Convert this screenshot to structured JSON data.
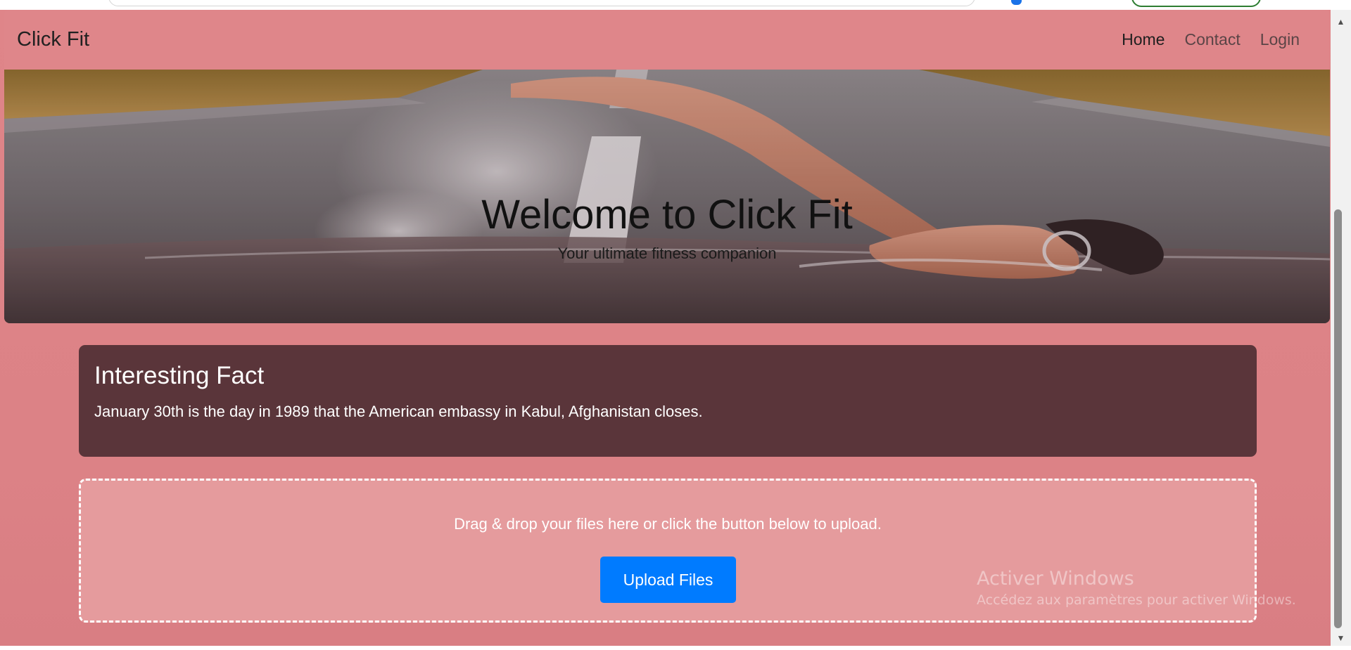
{
  "navbar": {
    "brand": "Click Fit",
    "links": [
      {
        "label": "Home",
        "active": true
      },
      {
        "label": "Contact",
        "active": false
      },
      {
        "label": "Login",
        "active": false
      }
    ]
  },
  "hero": {
    "title": "Welcome to Click Fit",
    "subtitle": "Your ultimate fitness companion"
  },
  "fact": {
    "title": "Interesting Fact",
    "text": "January 30th is the day in 1989 that the American embassy in Kabul, Afghanistan closes."
  },
  "upload": {
    "instructions": "Drag & drop your files here or click the button below to upload.",
    "button_label": "Upload Files"
  },
  "watermark": {
    "title": "Activer Windows",
    "subtitle": "Accédez aux paramètres pour activer Windows."
  },
  "colors": {
    "page_background": "#df8589",
    "fact_card": "#5a353a",
    "upload_zone": "#e59b9d",
    "primary_button": "#007bff"
  }
}
